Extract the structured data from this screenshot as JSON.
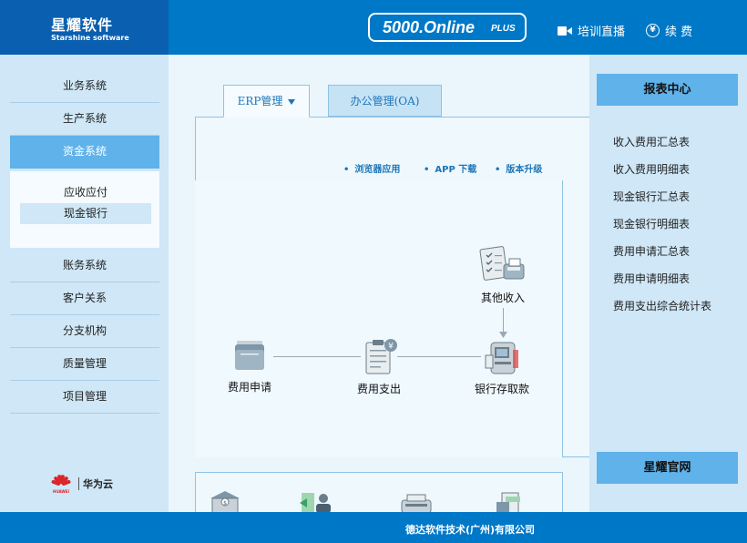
{
  "header": {
    "logo_cn": "星耀软件",
    "logo_en": "Starshine software",
    "product_name": "5000.Online",
    "product_suffix": "PLUS",
    "training_label": "培训直播",
    "renew_label": "续 费",
    "renew_icon_glyph": "¥"
  },
  "sidebar": {
    "items": [
      {
        "label": "业务系统"
      },
      {
        "label": "生产系统"
      },
      {
        "label": "资金系统"
      },
      {
        "label": "账务系统"
      },
      {
        "label": "客户关系"
      },
      {
        "label": "分支机构"
      },
      {
        "label": "质量管理"
      },
      {
        "label": "项目管理"
      }
    ],
    "subitems": [
      {
        "label": "应收应付"
      },
      {
        "label": "现金银行"
      }
    ],
    "partner": "华为云",
    "partner_logo_text": "HUAWEI"
  },
  "main": {
    "tabs": [
      {
        "label": "ERP管理"
      },
      {
        "label": "办公管理(OA)"
      }
    ],
    "sub_links": [
      {
        "label": "浏览器应用"
      },
      {
        "label": "APP 下载"
      },
      {
        "label": "版本升级"
      }
    ],
    "flow": {
      "nodes": [
        {
          "label": "费用申请"
        },
        {
          "label": "费用支出"
        },
        {
          "label": "银行存取款"
        },
        {
          "label": "其他收入"
        }
      ]
    }
  },
  "right_panel": {
    "title": "报表中心",
    "reports": [
      {
        "label": "收入费用汇总表"
      },
      {
        "label": "收入费用明细表"
      },
      {
        "label": "现金银行汇总表"
      },
      {
        "label": "现金银行明细表"
      },
      {
        "label": "费用申请汇总表"
      },
      {
        "label": "费用申请明细表"
      },
      {
        "label": "费用支出综合统计表"
      }
    ],
    "official_site": "星耀官网"
  },
  "footer": {
    "company": "德达软件技术(广州)有限公司"
  },
  "colors": {
    "header_bg": "#0078c8",
    "logo_bg": "#0a5fb0",
    "sidebar_bg": "#cfe7f7",
    "accent": "#5fb2ea",
    "link_blue": "#1d76b9"
  }
}
